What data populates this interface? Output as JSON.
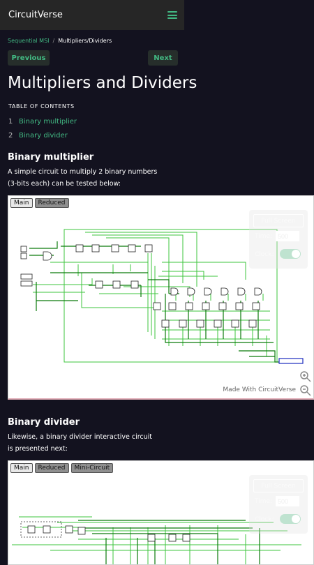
{
  "header": {
    "brand": "CircuitVerse"
  },
  "breadcrumb": {
    "parent": "Sequential MSI",
    "separator": "/",
    "current": "Multipliers/Dividers"
  },
  "nav": {
    "previous": "Previous",
    "next": "Next"
  },
  "page_title": "Multipliers and Dividers",
  "toc": {
    "title": "TABLE OF CONTENTS",
    "items": [
      {
        "num": "1",
        "label": "Binary multiplier"
      },
      {
        "num": "2",
        "label": "Binary divider"
      }
    ]
  },
  "sections": [
    {
      "heading": "Binary multiplier",
      "text": "A simple circuit to multiply 2 binary numbers (3-bits each) can be tested below:",
      "tabs": [
        "Main",
        "Reduced"
      ],
      "panel": {
        "fullscreen": "Full Screen",
        "time_label": "Time:",
        "time_value": "500",
        "clock_label": "Clock:"
      },
      "made_with": "Made With CircuitVerse"
    },
    {
      "heading": "Binary divider",
      "text": "Likewise, a binary divider interactive circuit is presented next:",
      "tabs": [
        "Main",
        "Reduced",
        "Mini-Circuit"
      ],
      "panel": {
        "fullscreen": "Full Screen",
        "time_label": "Time:",
        "time_value": "500",
        "clock_label": "Clock:"
      }
    }
  ],
  "colors": {
    "accent": "#42b983",
    "background": "#13121f",
    "wire": "#3ec43e",
    "wire_dark": "#0a7a0a"
  }
}
